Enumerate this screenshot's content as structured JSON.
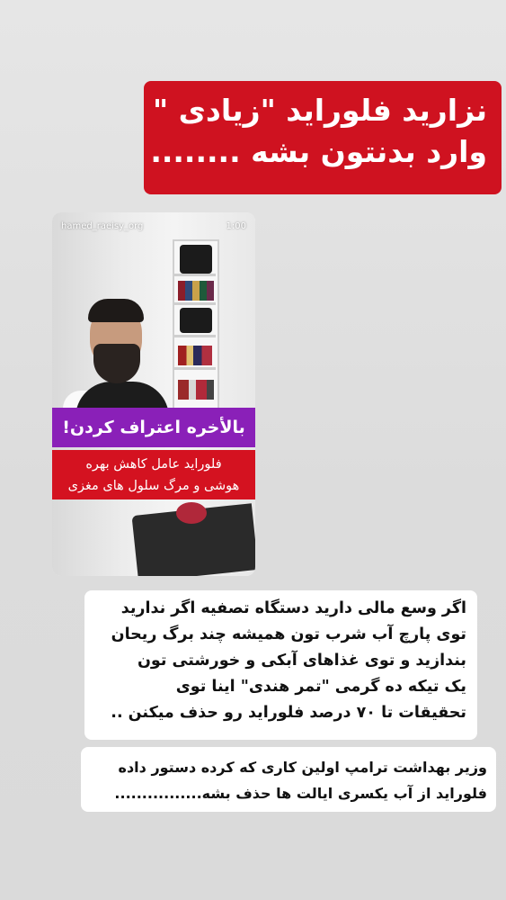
{
  "headline": {
    "line1": "نزارید فلوراید \"زیادی \"",
    "line2": "وارد بدنتون بشه ........"
  },
  "video": {
    "username": "hamed_raeisy_org",
    "duration": "1:00",
    "caption_purple": "بالأخره اعتراف کردن!",
    "caption_red_line1": "فلوراید عامل کاهش   بهره",
    "caption_red_line2": "هوشی و مرگ سلول های مغزی"
  },
  "tip_box": {
    "line1": "اگر وسع مالی دارید دستگاه تصفیه اگر ندارید",
    "line2": "توی پارچ آب شرب تون همیشه چند برگ ریحان",
    "line3": "بندازید و توی غذاهای آبکی    و خورشتی تون",
    "line4": "یک تیکه ده گرمی          \"تمر هندی\" اینا توی",
    "line5": "تحقیقات تا ۷۰ درصد فلوراید رو حذف میکنن .."
  },
  "news_box": {
    "line1": "وزیر بهداشت ترامپ اولین کاری که کرده دستور داده",
    "line2": "فلوراید از آب یکسری ایالت ها حذف بشه................"
  },
  "colors": {
    "headline_bg": "#cf1220",
    "purple_caption_bg": "#8a20b8",
    "red_caption_bg": "#d41220",
    "text_box_bg": "#ffffff"
  }
}
